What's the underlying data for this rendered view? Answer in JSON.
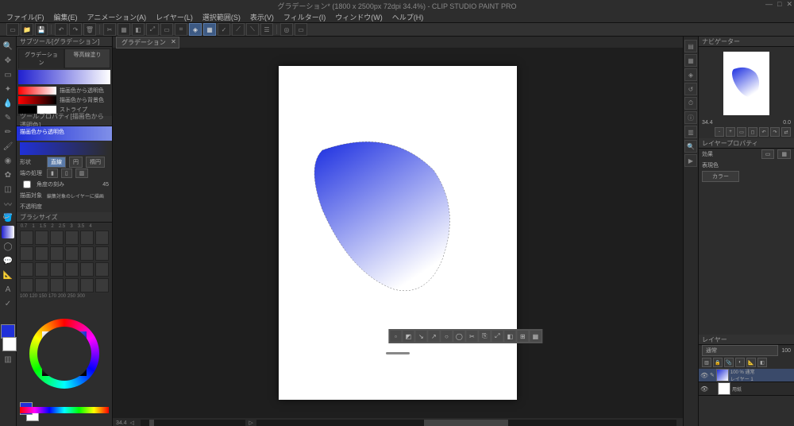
{
  "title": "グラデーション* (1800 x 2500px 72dpi 34.4%) - CLIP STUDIO PAINT PRO",
  "window_buttons": {
    "min": "—",
    "max": "□",
    "close": "✕"
  },
  "menu": [
    "ファイル(F)",
    "編集(E)",
    "アニメーション(A)",
    "レイヤー(L)",
    "選択範囲(S)",
    "表示(V)",
    "フィルター(I)",
    "ウィンドウ(W)",
    "ヘルプ(H)"
  ],
  "subtool": {
    "header": "サブツール[グラデーション]",
    "tabs": [
      "グラデーション",
      "等高線塗り"
    ],
    "rows": [
      {
        "label": "描画色から透明色"
      },
      {
        "label": "描画色から背景色"
      },
      {
        "label": "ストライプ"
      }
    ]
  },
  "toolprop": {
    "header": "ツールプロパティ[描画色から透明色]",
    "gradient_name": "描画色から透明色",
    "shape": {
      "label": "形状",
      "options": [
        "直線",
        "円",
        "楕円"
      ],
      "selected": "直線"
    },
    "edge": {
      "label": "端の処理"
    },
    "angle": {
      "label": "角度の刻み",
      "value": "45"
    },
    "target": {
      "label": "描画対象",
      "value": "編集対象のレイヤーに描画"
    },
    "opacity": {
      "label": "不透明度"
    }
  },
  "brushsize": {
    "header": "ブラシサイズ"
  },
  "canvas": {
    "tab": "グラデーション",
    "zoom": "34.4"
  },
  "navigator": {
    "header": "ナビゲーター",
    "zoom": "34.4",
    "angle": "0.0"
  },
  "layerprop": {
    "header": "レイヤープロパティ",
    "effects": "効果",
    "rendercolor": "表現色",
    "rendervalue": "カラー"
  },
  "layers": {
    "header": "レイヤー",
    "blend": "通常",
    "opacity": "100",
    "items": [
      {
        "mode": "100 % 通常",
        "name": "レイヤー 1",
        "selected": true
      },
      {
        "mode": "",
        "name": "用紙",
        "selected": false
      }
    ]
  }
}
